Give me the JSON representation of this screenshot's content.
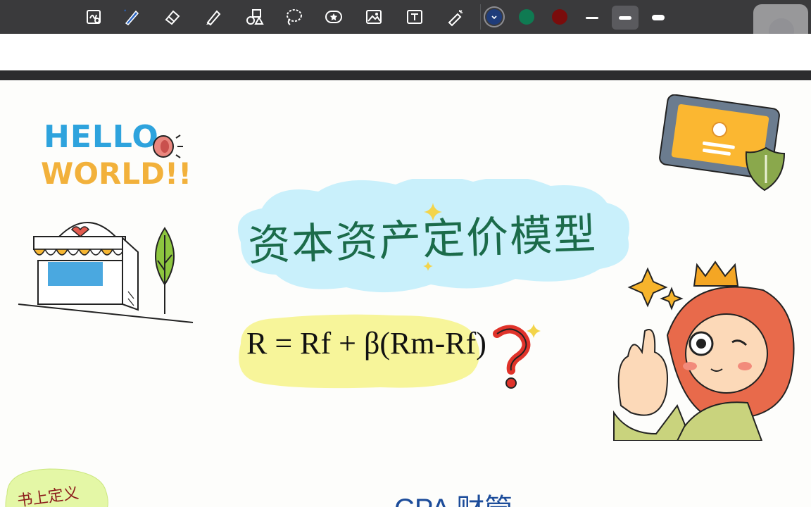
{
  "toolbar": {
    "tools": [
      {
        "name": "lasso-zoom-icon",
        "active": false
      },
      {
        "name": "pen-icon",
        "active": true
      },
      {
        "name": "eraser-icon",
        "active": false
      },
      {
        "name": "highlighter-icon",
        "active": false
      },
      {
        "name": "shapes-icon",
        "active": false
      },
      {
        "name": "lasso-select-icon",
        "active": false
      },
      {
        "name": "sticker-icon",
        "active": false
      },
      {
        "name": "image-icon",
        "active": false
      },
      {
        "name": "text-box-icon",
        "active": false
      },
      {
        "name": "laser-pointer-icon",
        "active": false
      }
    ],
    "colors": [
      {
        "name": "navy",
        "hex": "#1f3c7a",
        "selected": true
      },
      {
        "name": "green",
        "hex": "#0f7a52",
        "selected": false
      },
      {
        "name": "dark-red",
        "hex": "#7a0c0c",
        "selected": false
      }
    ],
    "stroke_widths": [
      "thin",
      "medium",
      "thick"
    ],
    "selected_stroke": "medium"
  },
  "note": {
    "sticker_hello": "HELLO",
    "sticker_world": "WORLD!!",
    "title": "资本资产定价模型",
    "formula": "R = Rf + β(Rm-Rf)",
    "bottom_left_text": "书上定义",
    "bottom_center_text": "CPA 财管"
  },
  "colors": {
    "title_ink": "#1b6b4a",
    "title_cloud": "#c9f0fb",
    "formula_ink": "#111111",
    "formula_highlight": "#f7f59a",
    "bottom_red_ink": "#8b1a1a",
    "bottom_blue_ink": "#1c4c9a",
    "bottom_left_bubble": "#e4f7a6"
  }
}
